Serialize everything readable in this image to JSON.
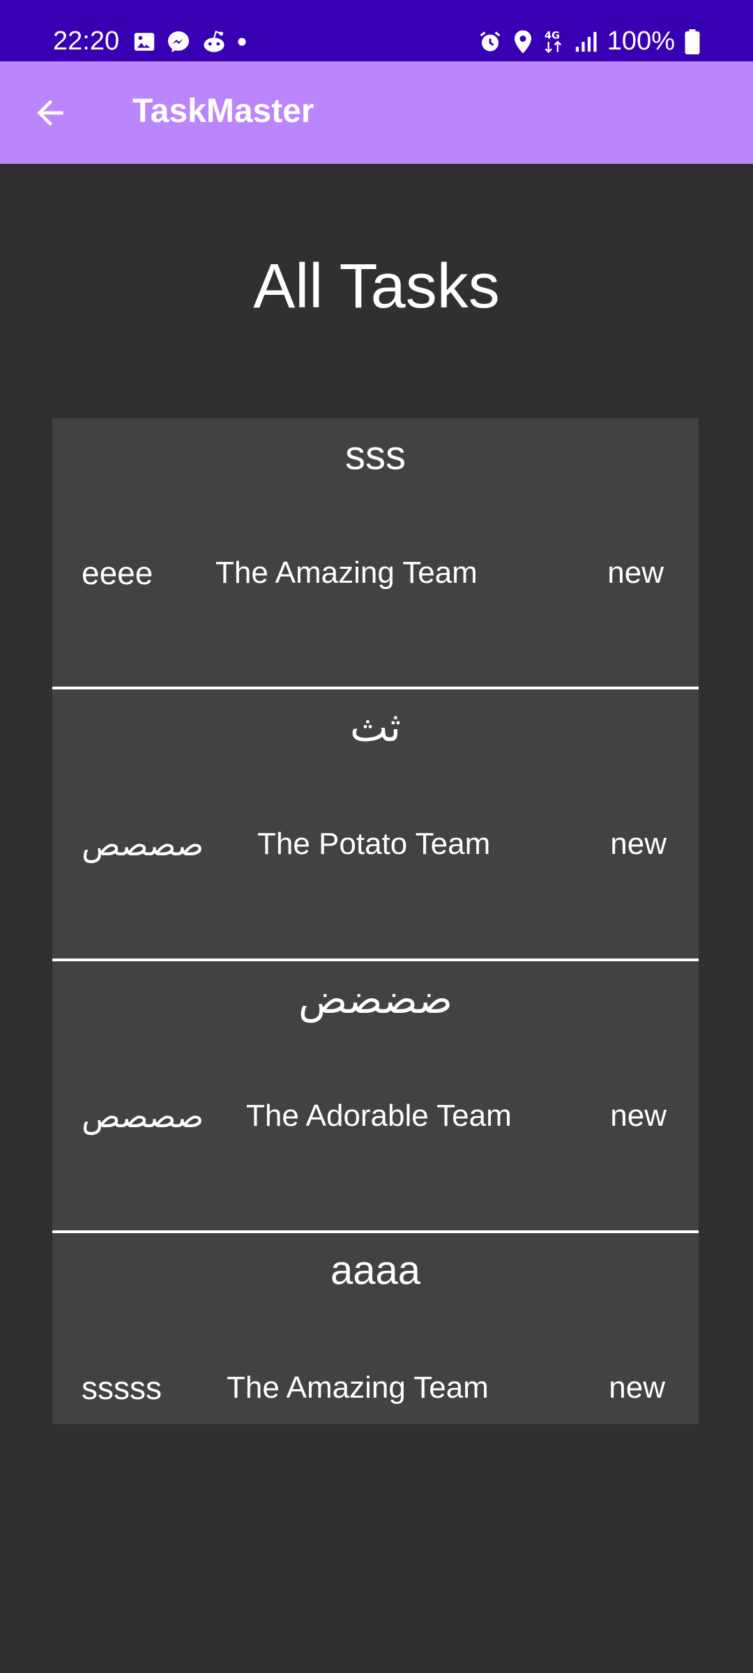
{
  "status_bar": {
    "time": "22:20",
    "battery": "100%",
    "network": "4G"
  },
  "app_bar": {
    "title": "TaskMaster"
  },
  "page": {
    "title": "All Tasks"
  },
  "tasks": [
    {
      "title": "sss",
      "body": "eeee",
      "team": "The Amazing Team",
      "state": "new"
    },
    {
      "title": "ثث",
      "body": "صصصص",
      "team": "The Potato Team",
      "state": "new"
    },
    {
      "title": "ضضضض",
      "body": "صصصص",
      "team": "The Adorable Team",
      "state": "new"
    },
    {
      "title": "aaaa",
      "body": "sssss",
      "team": "The Amazing Team",
      "state": "new"
    }
  ],
  "colors": {
    "status_bar": "#3700b3",
    "app_bar": "#bb86fc",
    "background": "#303030",
    "card": "#424242",
    "text": "#ffffff"
  },
  "icons": {
    "back": "arrow-back-icon",
    "gallery": "image-icon",
    "messenger": "messenger-icon",
    "reddit": "reddit-icon",
    "alarm": "alarm-icon",
    "location": "location-icon",
    "signal": "signal-icon",
    "battery": "battery-icon"
  }
}
